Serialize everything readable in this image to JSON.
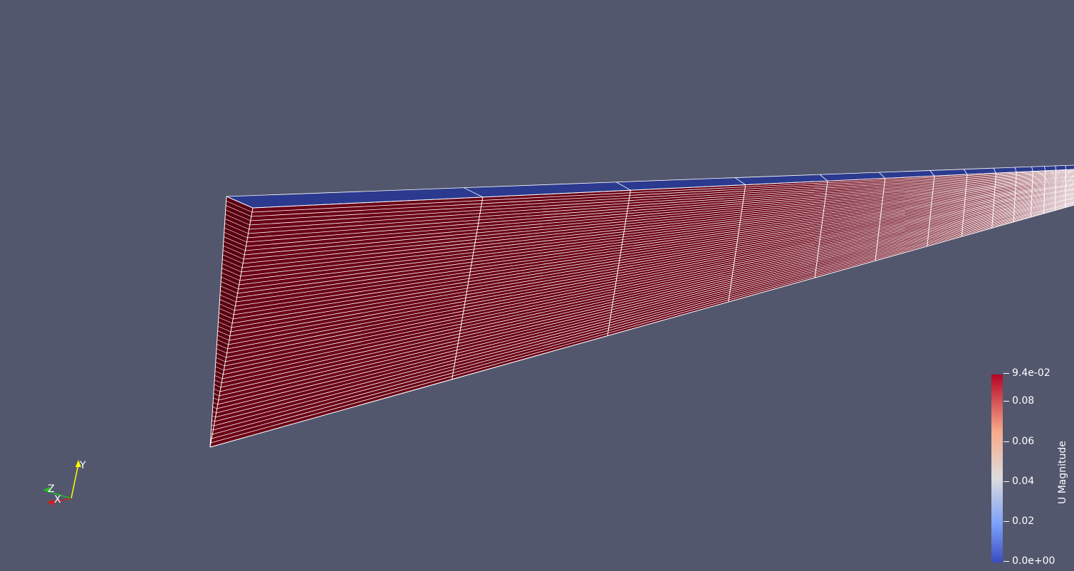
{
  "colors": {
    "background": "#52576e",
    "mesh_low": "#2b3a8f",
    "mesh_high": "#6a0014",
    "grid_lines": "#ffffff"
  },
  "colorbar": {
    "title": "U Magnitude",
    "min_label": "0.0e+00",
    "max_label": "9.4e-02",
    "ticks": [
      "0.08",
      "0.06",
      "0.04",
      "0.02"
    ],
    "colormap": [
      "#3b4cc0",
      "#7b9ff9",
      "#c0d4f5",
      "#dddcdc",
      "#f2cbb7",
      "#f7a889",
      "#ee8468",
      "#b40426"
    ]
  },
  "orientation_axes": {
    "x_label": "X",
    "y_label": "Y",
    "z_label": "Z"
  }
}
